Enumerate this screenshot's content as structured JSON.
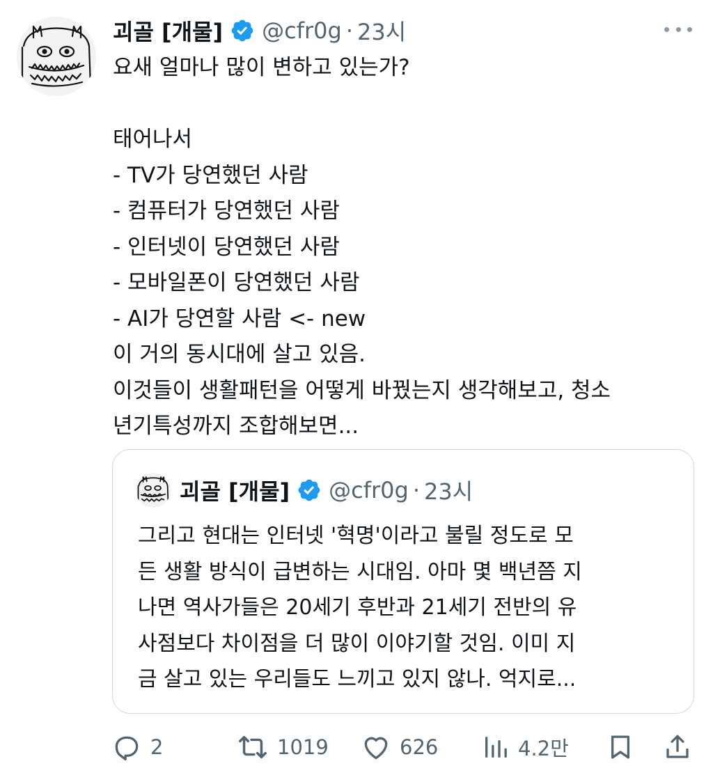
{
  "tweet": {
    "author_name": "괴골 [개물]",
    "handle": "@cfr0g",
    "separator": "·",
    "time": "23시",
    "lines": [
      "요새 얼마나 많이 변하고 있는가?",
      "",
      "태어나서",
      "- TV가 당연했던 사람",
      "- 컴퓨터가 당연했던 사람",
      "- 인터넷이 당연했던 사람",
      "- 모바일폰이 당연했던 사람",
      "- AI가 당연할 사람 <- new",
      "이 거의 동시대에 살고 있음.",
      "이것들이 생활패턴을 어떻게 바꿨는지 생각해보고, 청소",
      "년기특성까지 조합해보면..."
    ]
  },
  "quote": {
    "author_name": "괴골 [개물]",
    "handle": "@cfr0g",
    "separator": "·",
    "time": "23시",
    "lines": [
      "그리고 현대는 인터넷 '혁명'이라고 불릴 정도로 모",
      "든 생활 방식이 급변하는 시대임. 아마 몇 백년쯤 지",
      "나면 역사가들은 20세기 후반과 21세기 전반의 유",
      "사점보다 차이점을 더 많이 이야기할 것임. 이미 지",
      "금 살고 있는 우리들도 느끼고 있지 않나. 억지로..."
    ]
  },
  "actions": {
    "reply_count": "2",
    "retweet_count": "1019",
    "like_count": "626",
    "view_count": "4.2만"
  },
  "icons": {
    "verified": "verified-badge-icon",
    "more": "more-icon",
    "reply": "reply-icon",
    "retweet": "retweet-icon",
    "like": "heart-icon",
    "views": "views-icon",
    "bookmark": "bookmark-icon",
    "share": "share-icon"
  },
  "colors": {
    "verified_blue": "#1d9bf0",
    "secondary_text": "#536471",
    "border": "#cfd9de"
  }
}
